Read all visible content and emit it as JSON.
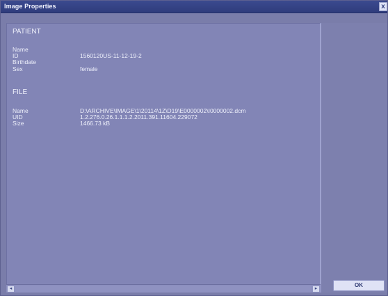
{
  "window": {
    "title": "Image Properties",
    "close_label": "x"
  },
  "patient": {
    "section_title": "PATIENT",
    "fields": [
      {
        "label": "Name",
        "value": ""
      },
      {
        "label": "ID",
        "value": "1560120US-11-12-19-2"
      },
      {
        "label": "Birthdate",
        "value": ""
      },
      {
        "label": "Sex",
        "value": "female"
      }
    ]
  },
  "file": {
    "section_title": "FILE",
    "fields": [
      {
        "label": "Name",
        "value": "D:\\ARCHIVE\\IMAGE\\1\\20114\\1Z\\D19\\E0000002\\I0000002.dcm"
      },
      {
        "label": "UID",
        "value": "1.2.276.0.26.1.1.1.2.2011.391.11604.229072"
      },
      {
        "label": "Size",
        "value": "1466.73 kB"
      }
    ]
  },
  "scrollbar": {
    "left_arrow": "◂",
    "right_arrow": "▸"
  },
  "buttons": {
    "ok_label": "OK"
  },
  "colors": {
    "window_bg": "#7a7daa",
    "panel_bg": "#8285b6",
    "titlebar_bg": "#2f3c7c",
    "text": "#eef0fb"
  }
}
